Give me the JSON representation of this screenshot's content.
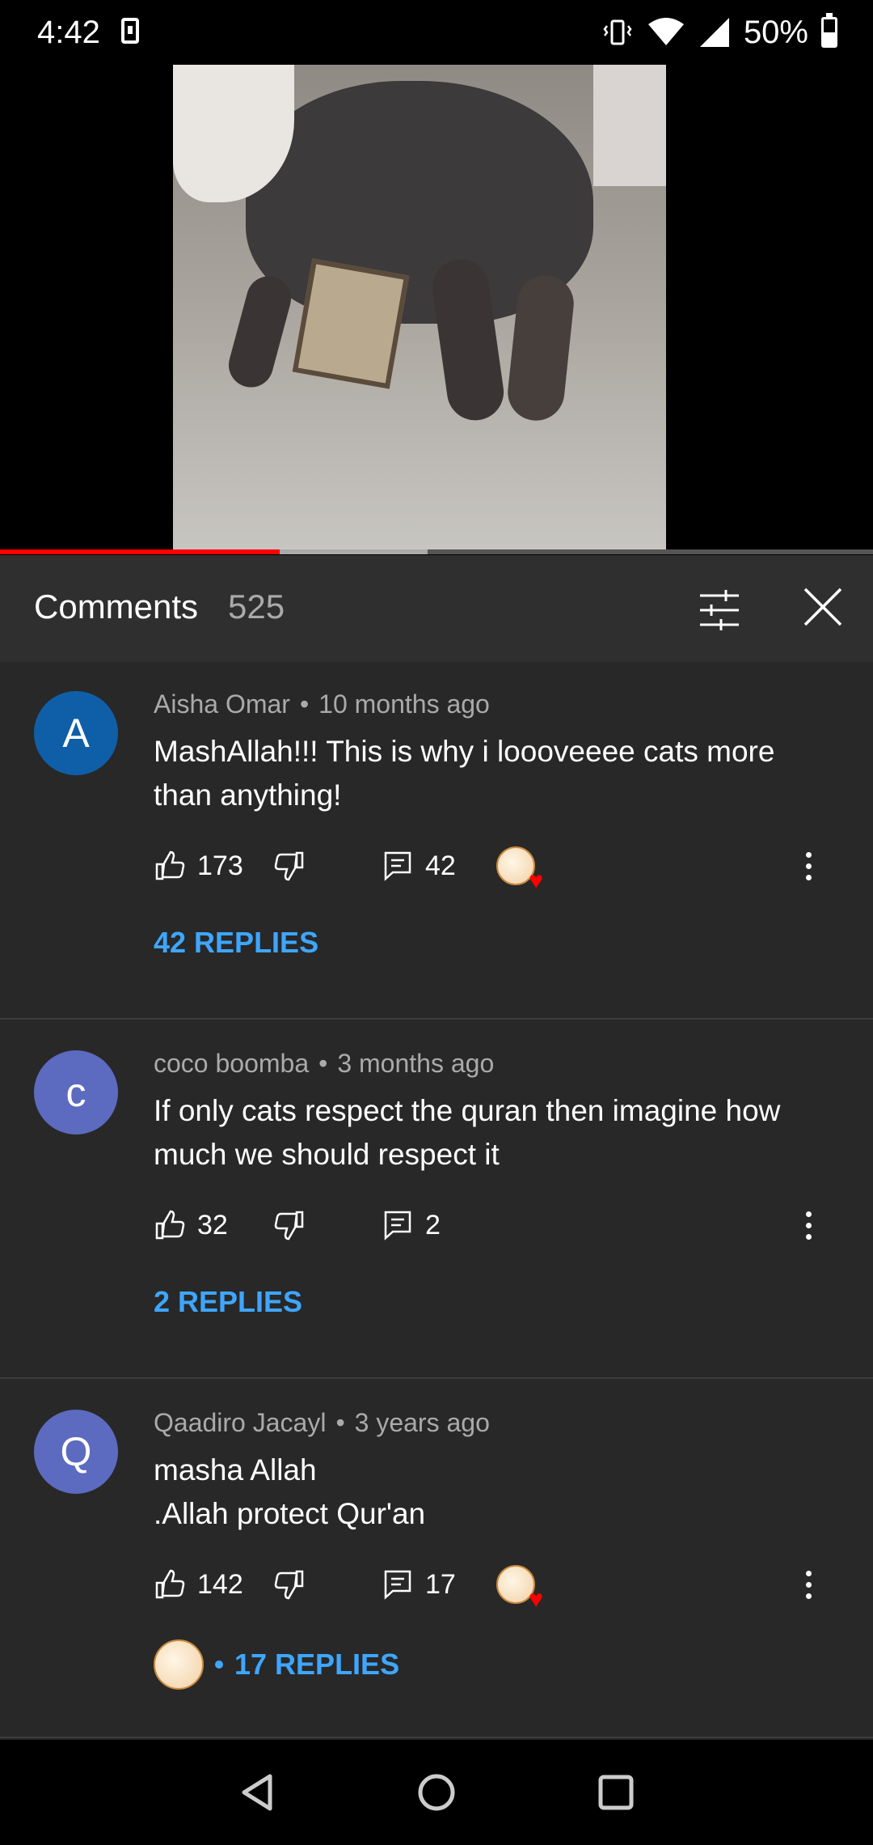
{
  "status_bar": {
    "time": "4:42",
    "battery": "50%"
  },
  "video": {
    "played_fraction": 0.32,
    "buffered_fraction": 0.49
  },
  "comments_panel": {
    "title": "Comments",
    "count": "525",
    "comments": [
      {
        "avatar_letter": "A",
        "avatar_color": "#0f5fa8",
        "author": "Aisha Omar",
        "time": "10 months ago",
        "text_lines": [
          "MashAllah!!! This is why i loooveeee cats more",
          "than anything!"
        ],
        "likes": "173",
        "reply_count": "42",
        "creator_heart": true,
        "replies_label": "42 REPLIES"
      },
      {
        "avatar_letter": "c",
        "avatar_color": "#5c6bc0",
        "author": "coco boomba",
        "time": "3 months ago",
        "text_lines": [
          "If only cats respect the quran then imagine how",
          "much we should respect it"
        ],
        "likes": "32",
        "reply_count": "2",
        "creator_heart": false,
        "replies_label": "2 REPLIES"
      },
      {
        "avatar_letter": "Q",
        "avatar_color": "#5c6bc0",
        "author": "Qaadiro Jacayl",
        "time": "3 years ago",
        "text_lines": [
          "masha Allah",
          ".Allah protect Qur'an"
        ],
        "likes": "142",
        "reply_count": "17",
        "creator_heart": true,
        "replies_label": "17 REPLIES"
      }
    ]
  },
  "icons": {
    "filter": "sliders-icon",
    "close": "close-icon",
    "like": "thumbs-up-icon",
    "dislike": "thumbs-down-icon",
    "reply": "comment-icon",
    "more": "more-vertical-icon",
    "nav_back": "triangle-back-icon",
    "nav_home": "circle-home-icon",
    "nav_recents": "square-recents-icon"
  },
  "colors": {
    "link": "#3ea6ff",
    "progress": "#ff0000",
    "panel_bg": "#282828"
  }
}
